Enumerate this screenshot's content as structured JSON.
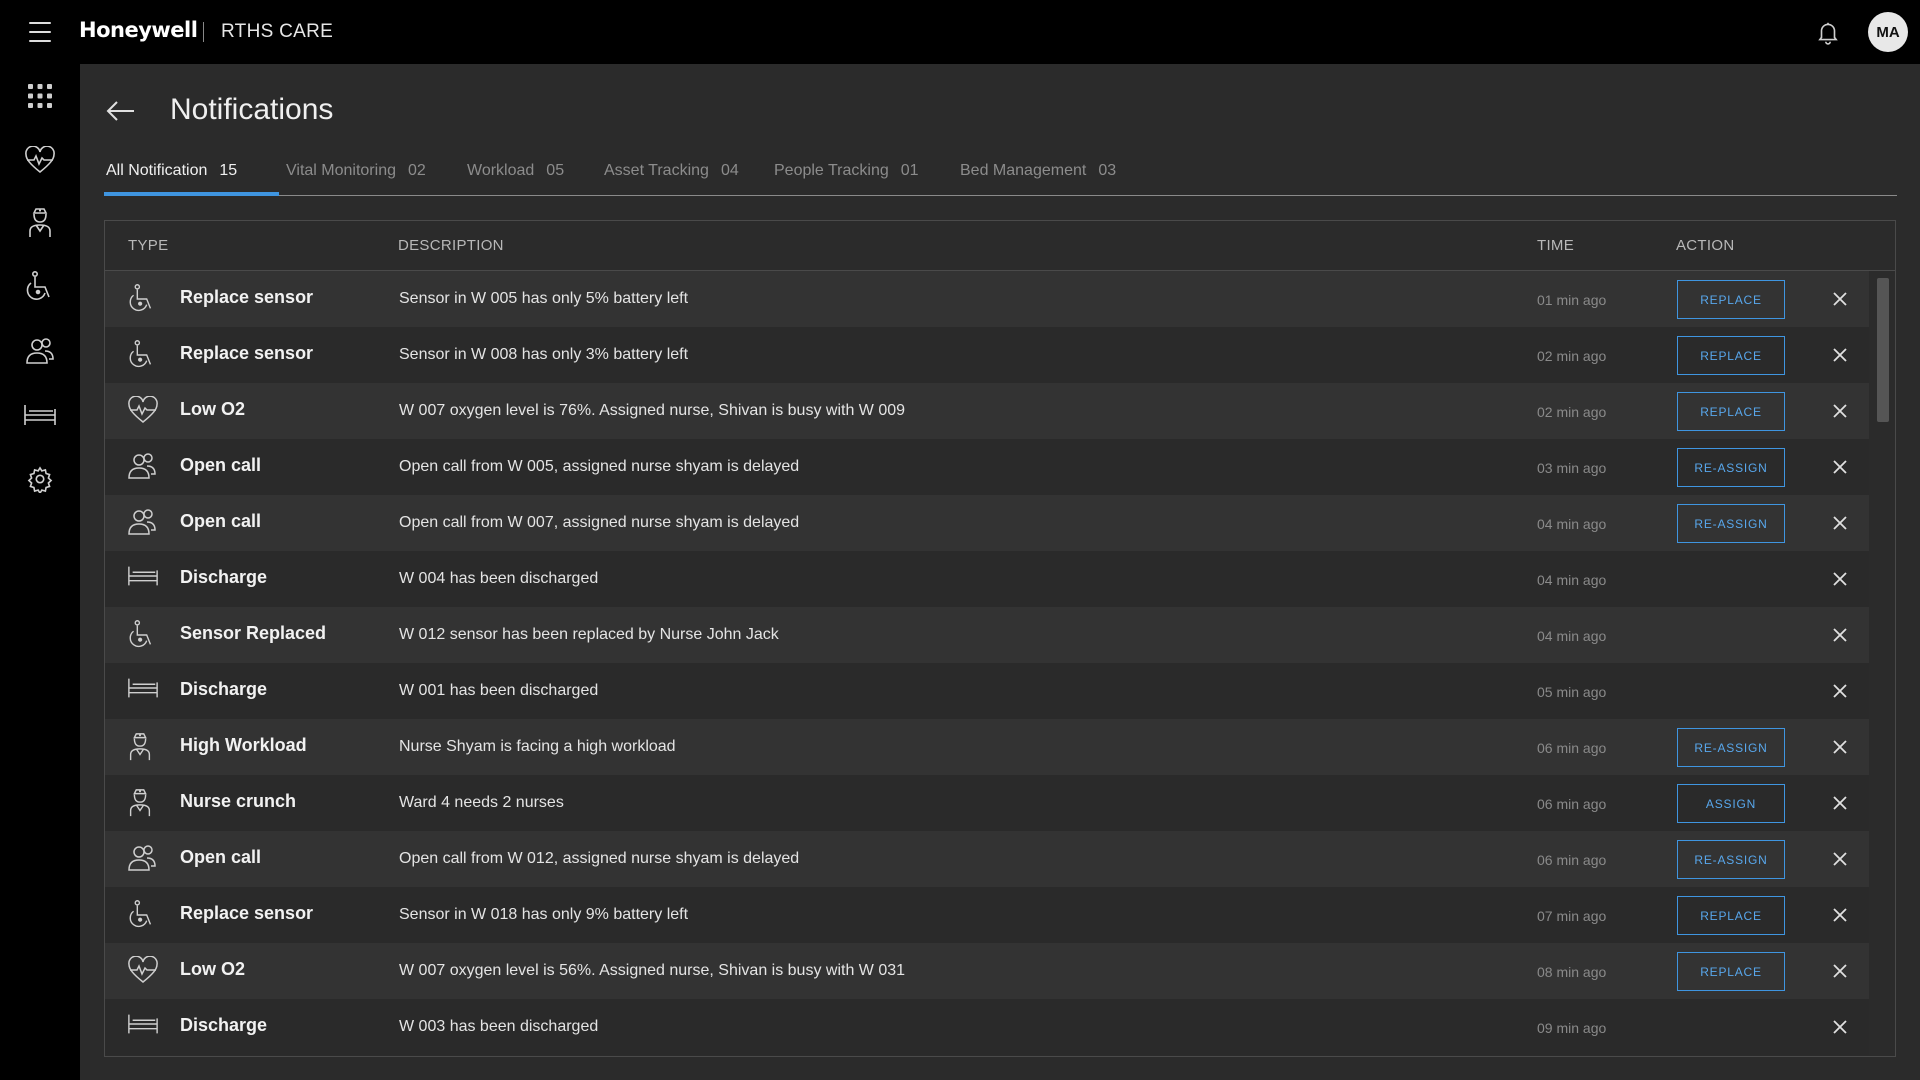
{
  "header": {
    "brand": "Honeywell",
    "app_name": "RTHS CARE",
    "avatar_initials": "MA"
  },
  "sidebar": {
    "items": [
      {
        "icon": "apps-grid-icon"
      },
      {
        "icon": "heart-pulse-icon"
      },
      {
        "icon": "nurse-icon"
      },
      {
        "icon": "wheelchair-icon"
      },
      {
        "icon": "people-icon"
      },
      {
        "icon": "bed-icon"
      },
      {
        "icon": "gear-icon"
      }
    ]
  },
  "page": {
    "title": "Notifications"
  },
  "tabs": [
    {
      "label": "All Notification",
      "count": "15",
      "active": true
    },
    {
      "label": "Vital Monitoring",
      "count": "02",
      "active": false
    },
    {
      "label": "Workload",
      "count": "05",
      "active": false
    },
    {
      "label": "Asset Tracking",
      "count": "04",
      "active": false
    },
    {
      "label": "People Tracking",
      "count": "01",
      "active": false
    },
    {
      "label": "Bed Management",
      "count": "03",
      "active": false
    }
  ],
  "table": {
    "headers": {
      "type": "TYPE",
      "description": "DESCRIPTION",
      "time": "TIME",
      "action": "ACTION"
    },
    "rows": [
      {
        "icon": "wheelchair-icon",
        "type": "Replace sensor",
        "description": "Sensor in W 005 has only 5% battery left",
        "time": "01 min ago",
        "action": "REPLACE"
      },
      {
        "icon": "wheelchair-icon",
        "type": "Replace sensor",
        "description": "Sensor in W 008 has only 3% battery left",
        "time": "02 min ago",
        "action": "REPLACE"
      },
      {
        "icon": "heart-pulse-icon",
        "type": "Low O2",
        "description": "W 007 oxygen level is 76%. Assigned nurse, Shivan is busy with W 009",
        "time": "02 min ago",
        "action": "REPLACE"
      },
      {
        "icon": "people-icon",
        "type": "Open call",
        "description": "Open call from W 005, assigned nurse shyam is delayed",
        "time": "03 min ago",
        "action": "RE-ASSIGN"
      },
      {
        "icon": "people-icon",
        "type": "Open call",
        "description": "Open call from W 007, assigned nurse shyam is delayed",
        "time": "04 min ago",
        "action": "RE-ASSIGN"
      },
      {
        "icon": "bed-icon",
        "type": "Discharge",
        "description": "W 004 has been discharged",
        "time": "04 min ago",
        "action": ""
      },
      {
        "icon": "wheelchair-icon",
        "type": "Sensor Replaced",
        "description": "W 012 sensor has been replaced by Nurse John Jack",
        "time": "04 min ago",
        "action": ""
      },
      {
        "icon": "bed-icon",
        "type": "Discharge",
        "description": "W 001 has been discharged",
        "time": "05 min ago",
        "action": ""
      },
      {
        "icon": "nurse-icon",
        "type": "High Workload",
        "description": "Nurse Shyam is facing a high workload",
        "time": "06 min ago",
        "action": "RE-ASSIGN"
      },
      {
        "icon": "nurse-icon",
        "type": "Nurse crunch",
        "description": "Ward 4 needs 2 nurses",
        "time": "06 min ago",
        "action": "ASSIGN"
      },
      {
        "icon": "people-icon",
        "type": "Open call",
        "description": "Open call from W 012, assigned nurse shyam is delayed",
        "time": "06 min ago",
        "action": "RE-ASSIGN"
      },
      {
        "icon": "wheelchair-icon",
        "type": "Replace sensor",
        "description": "Sensor in W 018 has only 9% battery left",
        "time": "07 min ago",
        "action": "REPLACE"
      },
      {
        "icon": "heart-pulse-icon",
        "type": "Low O2",
        "description": "W 007 oxygen level is 56%. Assigned nurse, Shivan is busy with W 031",
        "time": "08 min ago",
        "action": "REPLACE"
      },
      {
        "icon": "bed-icon",
        "type": "Discharge",
        "description": "W 003 has been discharged",
        "time": "09 min ago",
        "action": ""
      }
    ]
  },
  "colors": {
    "accent": "#3f95e0",
    "topbar": "#000000",
    "background": "#2b2b2b"
  }
}
